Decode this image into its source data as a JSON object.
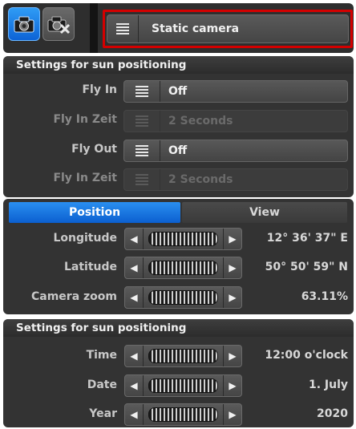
{
  "toolbar": {
    "camera_mode": "Static camera",
    "camera_icon": "camera-icon",
    "no_camera_icon": "camera-off-icon"
  },
  "fly_panel": {
    "title": "Settings for sun positioning",
    "rows": [
      {
        "label": "Fly In",
        "value": "Off",
        "enabled": true
      },
      {
        "label": "Fly In Zeit",
        "value": "2 Seconds",
        "enabled": false
      },
      {
        "label": "Fly Out",
        "value": "Off",
        "enabled": true
      },
      {
        "label": "Fly In Zeit",
        "value": "2 Seconds",
        "enabled": false
      }
    ]
  },
  "tabs": {
    "position": "Position",
    "view": "View",
    "active": "Position"
  },
  "position_panel": {
    "rows": [
      {
        "label": "Longitude",
        "value": "12° 36' 37\" E"
      },
      {
        "label": "Latitude",
        "value": "50° 50' 59\" N"
      },
      {
        "label": "Camera zoom",
        "value": "63.11%"
      }
    ]
  },
  "sun_panel": {
    "title": "Settings for sun positioning",
    "rows": [
      {
        "label": "Time",
        "value": "12:00 o'clock"
      },
      {
        "label": "Date",
        "value": "1. July"
      },
      {
        "label": "Year",
        "value": "2020"
      }
    ]
  },
  "colors": {
    "accent": "#0b6fe0",
    "highlight_border": "#d40000",
    "panel_bg": "#333333"
  }
}
